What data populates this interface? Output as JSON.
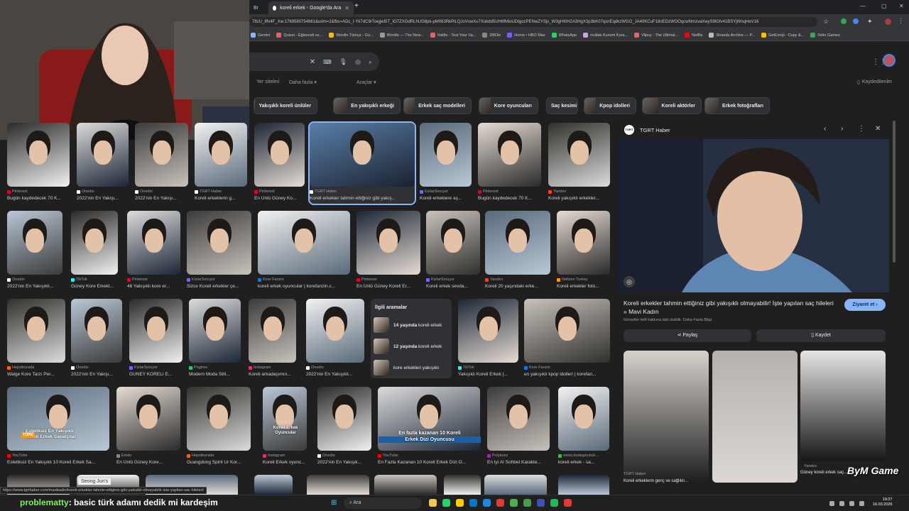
{
  "browser": {
    "tabs": [
      {
        "label": "Br"
      },
      {
        "label": "koreli erkek - Google'da Ara",
        "active": true
      }
    ],
    "url": "78zU_8fv4F_Xw:1768580754961&udm=2&fbs=ADc_I-Yk7dC9rToejjwI5T_IO7ZXGdRLhUG8pk-pM063RkPlLQJoVswXu7Xokdd5UH6fMioUDtgozPENwZYSjs_W3gHI0H2A3HgX3p3bK07qsnEqdkzWGO_JA40KCuF18oEDzWOOqcwNmzvaXwyS9lGfv41BSYjWnqHeV16",
    "bookmarks": [
      {
        "label": "Gemini",
        "color": "#8ab4f8"
      },
      {
        "label": "Quizei - Eğlenceli ve...",
        "color": "#e06666"
      },
      {
        "label": "Wordle Türkçe - Gü...",
        "color": "#fbbc04"
      },
      {
        "label": "Wordle — The New...",
        "color": "#999999"
      },
      {
        "label": "Valdle - Test Your Va...",
        "color": "#e06666"
      },
      {
        "label": "DBDle",
        "color": "#888888"
      },
      {
        "label": "Home • HBO Max",
        "color": "#7b5cff"
      },
      {
        "label": "WhatsApp",
        "color": "#25d366"
      },
      {
        "label": "mutlak Kuromi Kura...",
        "color": "#cfa0e8"
      },
      {
        "label": "Vlipsy - The Ultimat...",
        "color": "#e06666"
      },
      {
        "label": "Netflix",
        "color": "#e50914"
      },
      {
        "label": "Strands Archive — P...",
        "color": "#bbbbbb"
      },
      {
        "label": "GetEmoji - Copy &...",
        "color": "#fbbc04"
      },
      {
        "label": "Selin Games",
        "color": "#34a853"
      }
    ]
  },
  "search": {
    "menu": [
      "Yer siteleri",
      "Daha fazla ▾"
    ],
    "tools": "Araçlar ▾",
    "saved": "Kaydedilenler"
  },
  "chips": [
    "Yakışıklı koreli ünlüler",
    "En yakışıklı erkeği",
    "Erkek saç modelleri",
    "Kore oyuncuları",
    "Saç kesimi",
    "Kpop idolleri",
    "Koreli aktörler",
    "Erkek fotoğrafları"
  ],
  "results": {
    "row1": [
      {
        "source": "Pinterest",
        "title": "Bugün kaydedecek 70 K..."
      },
      {
        "source": "Onedio",
        "title": "2022'nin En Yakışı..."
      },
      {
        "source": "Onedio",
        "title": "2022'nin En Yakışı..."
      },
      {
        "source": "TGRT Haber",
        "title": "Koreli erkeklerin g..."
      },
      {
        "source": "Pinterest",
        "title": "En Ünlü Güney Ko..."
      },
      {
        "source": "TGRT Haber",
        "title": "Koreli erkekler tahmin ettiğiniz gibi yakış..."
      },
      {
        "source": "KizlarSoruyor",
        "title": "Koreli erkeklere aş..."
      },
      {
        "source": "Pinterest",
        "title": "Bugün kaydedecek 70 K..."
      },
      {
        "source": "Yandex",
        "title": "Koreli yakışıklı erkekler..."
      }
    ],
    "row2": [
      {
        "source": "Onedio",
        "title": "2022'nin En Yakışıklı..."
      },
      {
        "source": "TikTok",
        "title": "Güney Kore Erkekl..."
      },
      {
        "source": "Pinterest",
        "title": "46 Yakışıklı kore er..."
      },
      {
        "source": "KizlarSoruyor",
        "title": "Sizce Koreli erkekler çe..."
      },
      {
        "source": "Kore Fanzin",
        "title": "koreli erkek oyuncular | korefanzin.c..."
      },
      {
        "source": "Pinterest",
        "title": "En Ünlü Güney Koreli Er..."
      },
      {
        "source": "KizlarSoruyor",
        "title": "Koreli erkek sevda..."
      },
      {
        "source": "Yandex",
        "title": "Koreli 20 yaşındaki erke..."
      },
      {
        "source": "Nefizen Turkey",
        "title": "Koreli erkekler foto..."
      }
    ],
    "row3": [
      {
        "source": "Hepsiburada",
        "title": "Walge Kore Tarzı Per..."
      },
      {
        "source": "Onedio",
        "title": "2022'nin En Yakışı..."
      },
      {
        "source": "KizlarSoruyor",
        "title": "GÜNEY KORELİ E..."
      },
      {
        "source": "Pngtree",
        "title": "Modern Moda Stili..."
      },
      {
        "source": "Instagram",
        "title": "Koreli arkadaşımın..."
      },
      {
        "source": "Onedio",
        "title": "2022'nin En Yakışıklı..."
      },
      {
        "source": "TikTok",
        "title": "Yakışıklı Koreli Erkek |..."
      },
      {
        "source": "Kore Fanzin",
        "title": "en yakışıklı kpop idolleri | korefan..."
      }
    ],
    "row4": [
      {
        "source": "YouTube",
        "title": "Estetiksiz En Yakışıklı 10 Koreli Erkek Sa..."
      },
      {
        "source": "Edalo",
        "title": "En Ünlü Güney Kore..."
      },
      {
        "source": "Hepsiburada",
        "title": "Guangdong Spirit Ur Kor..."
      },
      {
        "source": "Instagram",
        "title": "Koreli Erkek oyunc..."
      },
      {
        "source": "Onedio",
        "title": "2022'nin En Yakışık..."
      },
      {
        "source": "YouTube",
        "title": "En Fazla Kazanan 10 Koreli Erkek Dizi O..."
      },
      {
        "source": "Polybuzz",
        "title": "En İyi AI Sohbet Karakte..."
      },
      {
        "source": "www.uludagsozluk...",
        "title": "koreli erkek - sa..."
      }
    ],
    "row4_overlays": {
      "estetik_line1": "Estetiksiz En Yakışıklı",
      "estetik_line2": "Koreli Erkek Sanatçılar",
      "topic": "TOPIC",
      "koreli_oyunc": "Koreli Erkek Oyuncular",
      "fazla_line1": "En fazla kazanan 10 Koreli",
      "fazla_line2": "Erkek Dizi Oyuncusu"
    },
    "related": {
      "title": "İlgili aramalar",
      "items": [
        {
          "bold": "14 yaşında",
          "rest": " koreli erkek"
        },
        {
          "bold": "12 yaşında",
          "rest": " koreli erkek"
        },
        {
          "bold": "",
          "rest": "kore erkekleri yakışıklı"
        }
      ]
    },
    "bottom_partial": "Seong Jun's"
  },
  "panel": {
    "source": "TGRT Haber",
    "title": "Koreli erkekler tahmin ettiğiniz gibi yakışıklı olmayabilir! İşte yapılan saç hileleri » Mavi Kadın",
    "visit": "Ziyaret et",
    "copyright": "Görseller telif hakkına tabi olabilir.",
    "more_info": "Daha Fazla Bilgi",
    "share": "Paylaş",
    "save": "Kaydet",
    "related_bottom": [
      {
        "source": "TGRT Haber",
        "title": "Koreli erkeklerin genç ve sağlıklı..."
      },
      {
        "source": "Yandex",
        "title": "Güney koreli erkek saç..."
      }
    ]
  },
  "status_url": "https://www.tgrthaber.com/mavikadin/koreli-erkekler-tahmin-ettiginiz-gibi-yakisikli-olmayabilir-iste-yapilan-sac-hileleri/",
  "chat": {
    "user": "problematty",
    "message": ": basic türk adamı dedik mi kardeşim"
  },
  "taskbar": {
    "search": "Ara",
    "time": "19:27",
    "date": "16.03.2026"
  },
  "watermark": "ByM Game"
}
